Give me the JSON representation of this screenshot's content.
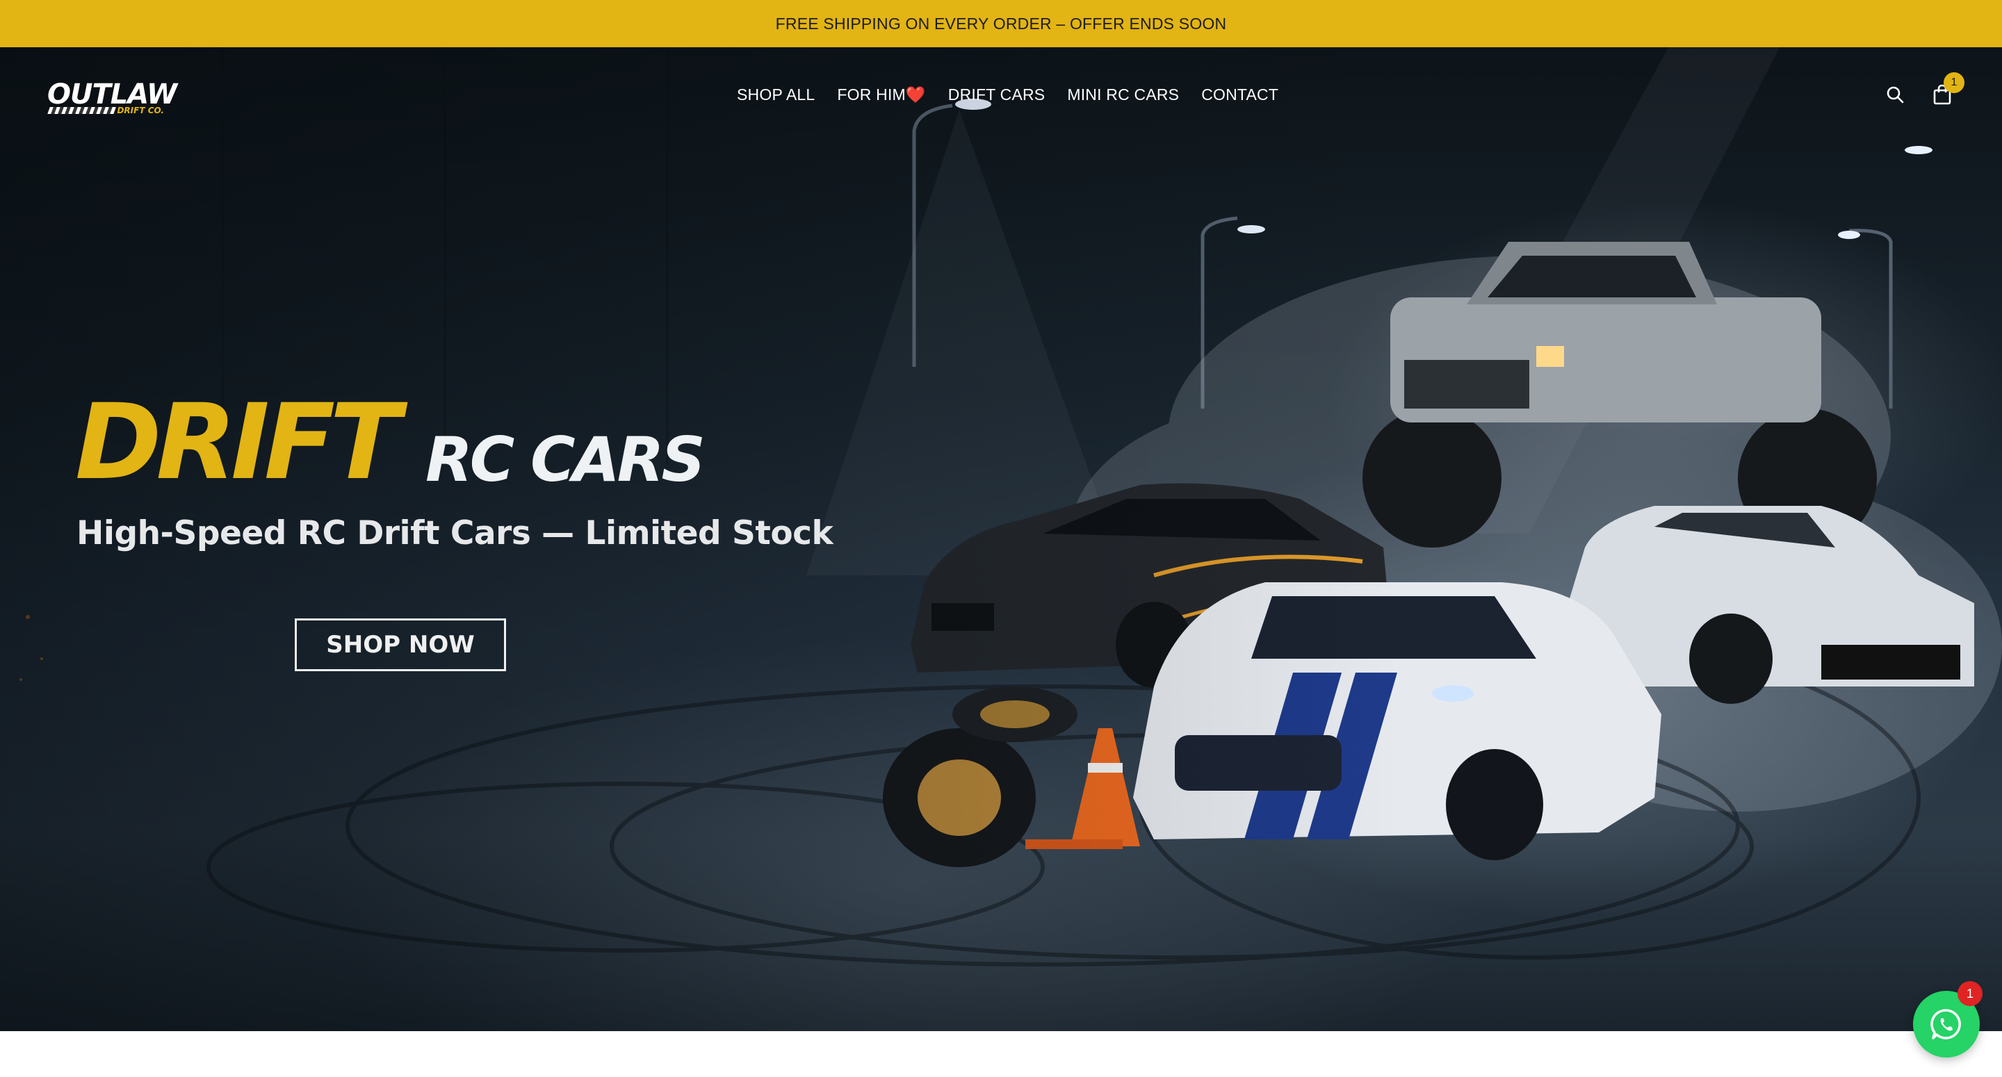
{
  "announcement": {
    "text": "FREE SHIPPING ON EVERY ORDER – OFFER ENDS SOON"
  },
  "brand": {
    "name": "OUTLAW",
    "sub": "DRIFT CO."
  },
  "nav": {
    "items": [
      {
        "label": "SHOP ALL"
      },
      {
        "label": "FOR HIM❤️"
      },
      {
        "label": "DRIFT CARS"
      },
      {
        "label": "MINI RC CARS"
      },
      {
        "label": "CONTACT"
      }
    ]
  },
  "header_icons": {
    "search": "search-icon",
    "cart": "shopping-bag-icon",
    "cart_count": "1"
  },
  "hero": {
    "title_accent": "DRIFT",
    "title_rest": "RC CARS",
    "tagline": "High-Speed RC Drift Cars — Limited Stock",
    "cta_label": "SHOP NOW"
  },
  "whatsapp": {
    "icon": "whatsapp-icon",
    "badge_count": "1"
  },
  "colors": {
    "accent": "#e2b414",
    "whatsapp": "#25d366",
    "badge": "#e02424"
  }
}
